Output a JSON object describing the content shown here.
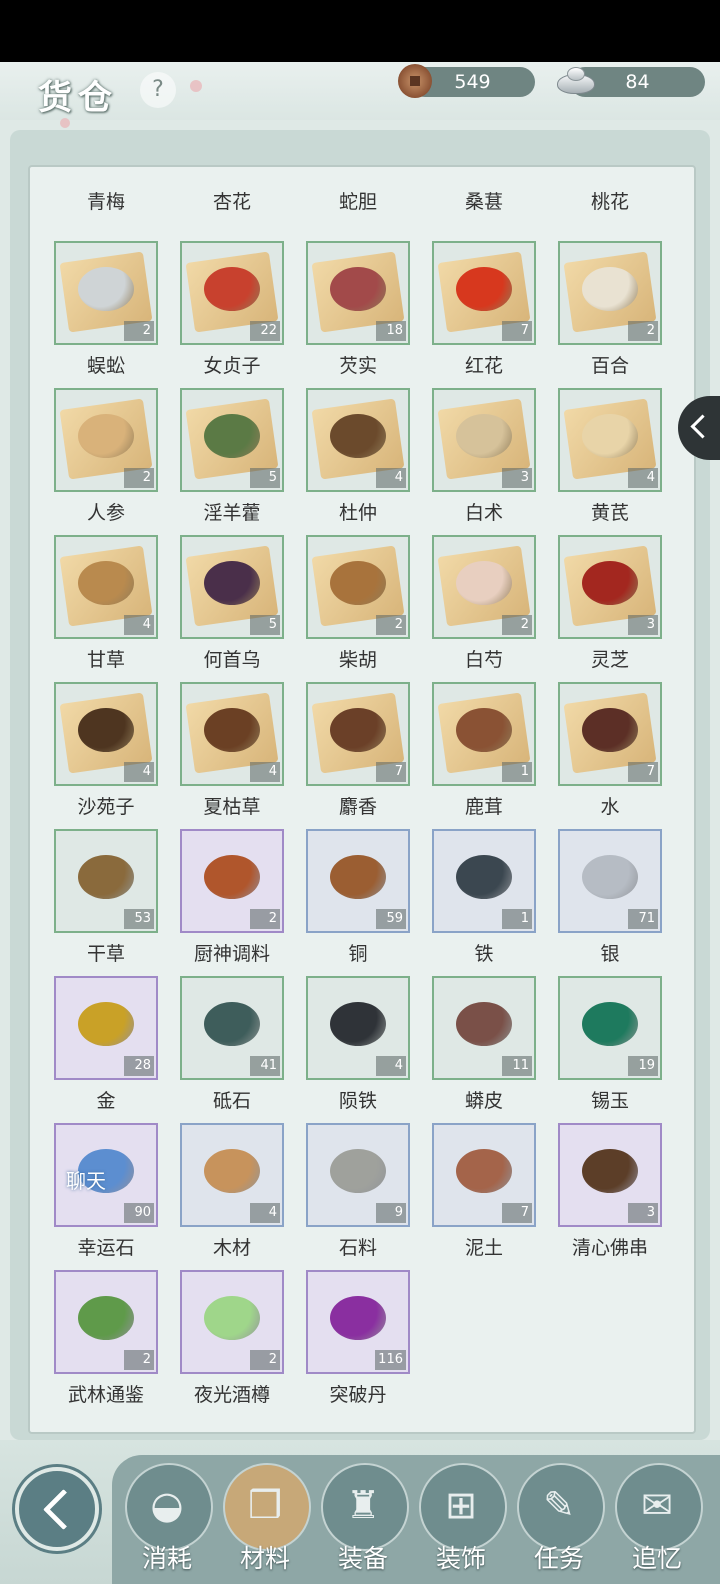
{
  "header": {
    "title": "货仓",
    "help_label": "?",
    "copper": "549",
    "silver": "84"
  },
  "items": [
    {
      "name": "青梅",
      "count": "",
      "style": "green"
    },
    {
      "name": "杏花",
      "count": "",
      "style": "green"
    },
    {
      "name": "蛇胆",
      "count": "",
      "style": "green"
    },
    {
      "name": "桑葚",
      "count": "",
      "style": "green"
    },
    {
      "name": "桃花",
      "count": "",
      "style": "green"
    },
    {
      "name": "蜈蚣",
      "count": "2",
      "style": "green",
      "color": "#cfd4d6"
    },
    {
      "name": "女贞子",
      "count": "22",
      "style": "green",
      "color": "#c8412e"
    },
    {
      "name": "芡实",
      "count": "18",
      "style": "green",
      "color": "#a24a4a"
    },
    {
      "name": "红花",
      "count": "7",
      "style": "green",
      "color": "#d7381e"
    },
    {
      "name": "百合",
      "count": "2",
      "style": "green",
      "color": "#e9e2d2"
    },
    {
      "name": "人参",
      "count": "2",
      "style": "green",
      "color": "#d9b27a"
    },
    {
      "name": "淫羊藿",
      "count": "5",
      "style": "green",
      "color": "#5b7a45"
    },
    {
      "name": "杜仲",
      "count": "4",
      "style": "green",
      "color": "#6b4a2c"
    },
    {
      "name": "白术",
      "count": "3",
      "style": "green",
      "color": "#d6c29a"
    },
    {
      "name": "黄芪",
      "count": "4",
      "style": "green",
      "color": "#e8d4a8"
    },
    {
      "name": "甘草",
      "count": "4",
      "style": "green",
      "color": "#b98a4e"
    },
    {
      "name": "何首乌",
      "count": "5",
      "style": "green",
      "color": "#4a2f4a"
    },
    {
      "name": "柴胡",
      "count": "2",
      "style": "green",
      "color": "#a8733c"
    },
    {
      "name": "白芍",
      "count": "2",
      "style": "green",
      "color": "#e8cfc0"
    },
    {
      "name": "灵芝",
      "count": "3",
      "style": "green",
      "color": "#a3271f"
    },
    {
      "name": "沙苑子",
      "count": "4",
      "style": "green",
      "color": "#4e3520"
    },
    {
      "name": "夏枯草",
      "count": "4",
      "style": "green",
      "color": "#6b4024"
    },
    {
      "name": "麝香",
      "count": "7",
      "style": "green",
      "color": "#6b4028"
    },
    {
      "name": "鹿茸",
      "count": "1",
      "style": "green",
      "color": "#8a5234"
    },
    {
      "name": "水",
      "count": "7",
      "style": "green",
      "color": "#5c2f26"
    },
    {
      "name": "干草",
      "count": "53",
      "style": "green",
      "color": "#8a6a3c"
    },
    {
      "name": "厨神调料",
      "count": "2",
      "style": "purple",
      "color": "#b0562c"
    },
    {
      "name": "铜",
      "count": "59",
      "style": "blue",
      "color": "#9b5e32"
    },
    {
      "name": "铁",
      "count": "1",
      "style": "blue",
      "color": "#3b4750"
    },
    {
      "name": "银",
      "count": "71",
      "style": "blue",
      "color": "#b6bcc4"
    },
    {
      "name": "金",
      "count": "28",
      "style": "purple",
      "color": "#c9a127"
    },
    {
      "name": "砥石",
      "count": "41",
      "style": "green",
      "color": "#3e5d5b"
    },
    {
      "name": "陨铁",
      "count": "4",
      "style": "green",
      "color": "#2f3338"
    },
    {
      "name": "蟒皮",
      "count": "11",
      "style": "green",
      "color": "#7a5048"
    },
    {
      "name": "锡玉",
      "count": "19",
      "style": "green",
      "color": "#1e7a5e"
    },
    {
      "name": "幸运石",
      "count": "90",
      "style": "purple",
      "color": "#5c8ed0",
      "overlay": "聊天"
    },
    {
      "name": "木材",
      "count": "4",
      "style": "blue",
      "color": "#c7935c"
    },
    {
      "name": "石料",
      "count": "9",
      "style": "blue",
      "color": "#9fa19c"
    },
    {
      "name": "泥土",
      "count": "7",
      "style": "blue",
      "color": "#a4644a"
    },
    {
      "name": "清心佛串",
      "count": "3",
      "style": "purple",
      "color": "#5c3e28"
    },
    {
      "name": "武林通鉴",
      "count": "2",
      "style": "purple",
      "color": "#5f9a4a"
    },
    {
      "name": "夜光酒樽",
      "count": "2",
      "style": "purple",
      "color": "#9fd68a"
    },
    {
      "name": "突破丹",
      "count": "116",
      "style": "purple",
      "color": "#8a2fa0"
    }
  ],
  "nav": [
    {
      "label": "消耗",
      "glyph": "◒",
      "active": false
    },
    {
      "label": "材料",
      "glyph": "❒",
      "active": true
    },
    {
      "label": "装备",
      "glyph": "♜",
      "active": false
    },
    {
      "label": "装饰",
      "glyph": "⊞",
      "active": false
    },
    {
      "label": "任务",
      "glyph": "✎",
      "active": false
    },
    {
      "label": "追忆",
      "glyph": "✉",
      "active": false
    }
  ],
  "colors": {
    "accent": "#7db08a",
    "nav_bg": "#8ea7a6",
    "active_tab": "#c7a878"
  }
}
